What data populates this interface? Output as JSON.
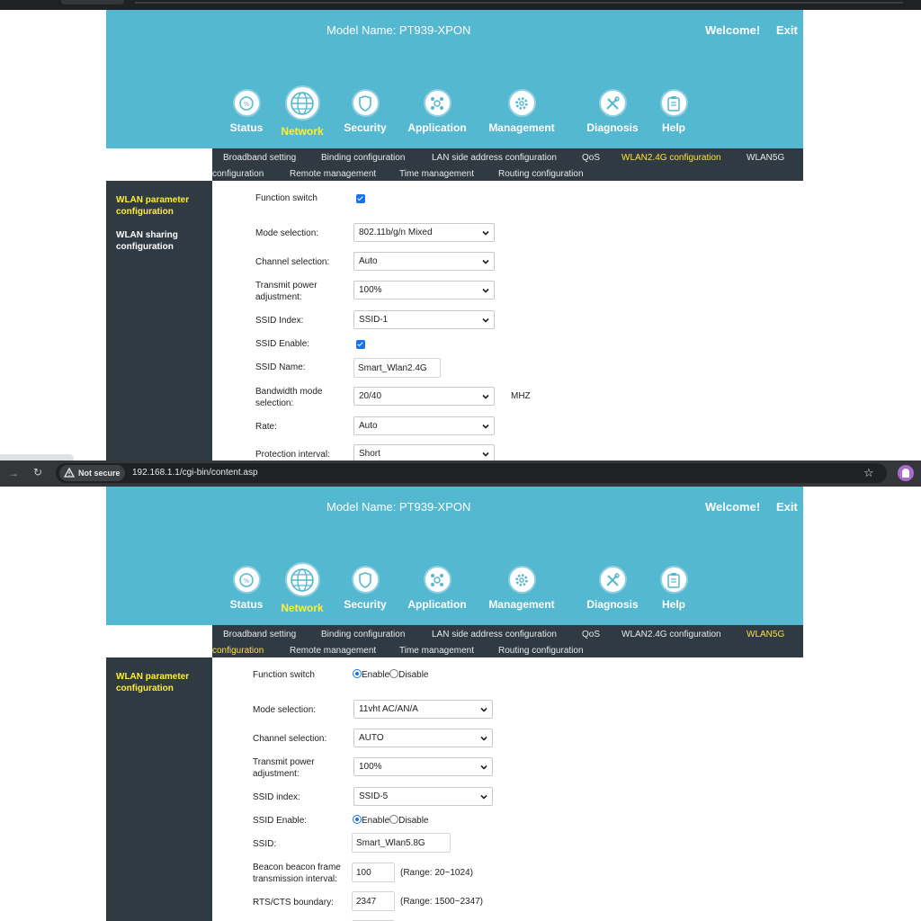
{
  "header": {
    "model_name": "Model Name: PT939-XPON",
    "welcome": "Welcome!",
    "exit": "Exit"
  },
  "nav": [
    {
      "label": "Status",
      "icon": "status-icon"
    },
    {
      "label": "Network",
      "icon": "globe-icon",
      "active": true
    },
    {
      "label": "Security",
      "icon": "shield-icon"
    },
    {
      "label": "Application",
      "icon": "application-icon"
    },
    {
      "label": "Management",
      "icon": "gear-icon"
    },
    {
      "label": "Diagnosis",
      "icon": "tools-icon"
    },
    {
      "label": "Help",
      "icon": "clipboard-icon"
    }
  ],
  "subnav": {
    "broadband": "Broadband setting",
    "binding": "Binding configuration",
    "lan": "LAN side address configuration",
    "qos": "QoS",
    "wlan24": "WLAN2.4G configuration",
    "wlan5g_a": "WLAN5G",
    "wlan5g_b": "configuration",
    "remote": "Remote management",
    "time": "Time management",
    "routing": "Routing configuration"
  },
  "panel1": {
    "sidebar": {
      "item1": "WLAN parameter configuration",
      "item2": "WLAN sharing configuration"
    },
    "fields": {
      "function_switch": "Function switch",
      "mode_label": "Mode selection:",
      "mode_value": "802.11b/g/n Mixed",
      "channel_label": "Channel selection:",
      "channel_value": "Auto",
      "power_label": "Transmit power adjustment:",
      "power_value": "100%",
      "ssid_index_label": "SSID Index:",
      "ssid_index_value": "SSID-1",
      "ssid_enable_label": "SSID Enable:",
      "ssid_name_label": "SSID Name:",
      "ssid_name_value": "Smart_Wlan2.4G",
      "bandwidth_label": "Bandwidth mode selection:",
      "bandwidth_value": "20/40",
      "bandwidth_unit": "MHZ",
      "rate_label": "Rate:",
      "rate_value": "Auto",
      "guard_label": "Protection interval:",
      "guard_value": "Short"
    }
  },
  "browser": {
    "not_secure": "Not secure",
    "url": "192.168.1.1/cgi-bin/content.asp"
  },
  "panel2": {
    "sidebar": {
      "item1": "WLAN parameter configuration"
    },
    "fields": {
      "function_switch": "Function switch",
      "enable": "Enable",
      "disable": "Disable",
      "mode_label": "Mode selection:",
      "mode_value": "11vht AC/AN/A",
      "channel_label": "Channel selection:",
      "channel_value": "AUTO",
      "power_label": "Transmit power adjustment:",
      "power_value": "100%",
      "ssid_index_label": "SSID index:",
      "ssid_index_value": "SSID-5",
      "ssid_enable_label": "SSID Enable:",
      "ssid_label": "SSID:",
      "ssid_value": "Smart_Wlan5.8G",
      "beacon_label": "Beacon beacon frame transmission interval:",
      "beacon_value": "100",
      "beacon_range": "(Range: 20~1024)",
      "rts_label": "RTS/CTS boundary:",
      "rts_value": "2347",
      "rts_range": "(Range: 1500~2347)"
    }
  }
}
